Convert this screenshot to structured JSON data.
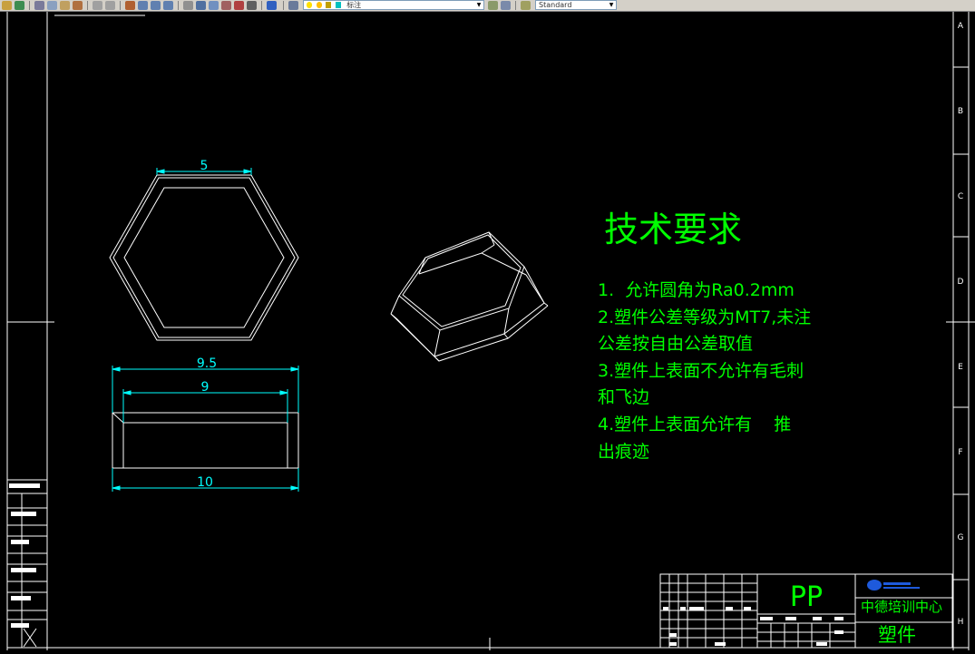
{
  "toolbar": {
    "layer_name": "标注",
    "text_style": "Standard"
  },
  "tech_requirements": {
    "title": "技术要求",
    "lines": [
      "1.  允许圆角为Ra0.2mm",
      "2.塑件公差等级为MT7,未注",
      "公差按自由公差取值",
      "3.塑件上表面不允许有毛刺",
      "和飞边",
      "4.塑件上表面允许有    推",
      "出痕迹"
    ]
  },
  "dimensions": {
    "hex_top": "5",
    "overall_width": "9.5",
    "inner_width": "9",
    "bottom_width": "10"
  },
  "title_block": {
    "material": "PP",
    "company": "中德培训中心",
    "part_name": "塑件"
  },
  "zone_letters": [
    "A",
    "B",
    "C",
    "D",
    "E",
    "F",
    "G",
    "H"
  ],
  "colors": {
    "drawing_bg": "#000000",
    "geometry": "#ffffff",
    "dimension": "#00ffff",
    "text": "#00ff00",
    "frame": "#ffffff"
  }
}
